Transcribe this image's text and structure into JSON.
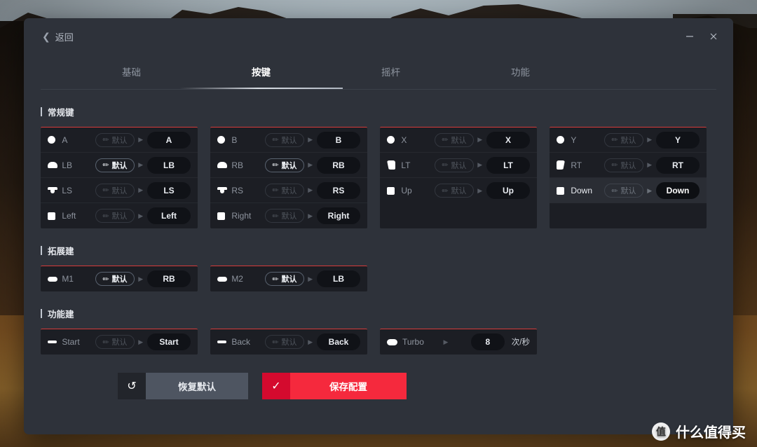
{
  "window": {
    "back_label": "返回",
    "minimize_icon": "minimize-icon",
    "close_icon": "close-icon"
  },
  "tabs": [
    {
      "label": "基础",
      "active": false
    },
    {
      "label": "按键",
      "active": true
    },
    {
      "label": "摇杆",
      "active": false
    },
    {
      "label": "功能",
      "active": false
    }
  ],
  "sections": [
    {
      "title": "常规键",
      "columns": [
        {
          "rows": [
            {
              "icon": "circle-button-icon",
              "icon_class": "ic-circle",
              "label": "A",
              "default_label": "默认",
              "default_active": false,
              "value": "A",
              "highlight": false
            },
            {
              "icon": "bumper-icon",
              "icon_class": "ic-bumper",
              "label": "LB",
              "default_label": "默认",
              "default_active": true,
              "value": "LB",
              "highlight": false
            },
            {
              "icon": "stick-icon",
              "icon_class": "ic-stick",
              "label": "LS",
              "default_label": "默认",
              "default_active": false,
              "value": "LS",
              "highlight": false
            },
            {
              "icon": "dpad-icon",
              "icon_class": "ic-dpad",
              "label": "Left",
              "default_label": "默认",
              "default_active": false,
              "value": "Left",
              "highlight": false
            }
          ]
        },
        {
          "rows": [
            {
              "icon": "circle-button-icon",
              "icon_class": "ic-circle",
              "label": "B",
              "default_label": "默认",
              "default_active": false,
              "value": "B",
              "highlight": false
            },
            {
              "icon": "bumper-icon",
              "icon_class": "ic-bumper",
              "label": "RB",
              "default_label": "默认",
              "default_active": true,
              "value": "RB",
              "highlight": false
            },
            {
              "icon": "stick-icon",
              "icon_class": "ic-stick",
              "label": "RS",
              "default_label": "默认",
              "default_active": false,
              "value": "RS",
              "highlight": false
            },
            {
              "icon": "dpad-icon",
              "icon_class": "ic-dpad",
              "label": "Right",
              "default_label": "默认",
              "default_active": false,
              "value": "Right",
              "highlight": false
            }
          ]
        },
        {
          "rows": [
            {
              "icon": "circle-button-icon",
              "icon_class": "ic-circle",
              "label": "X",
              "default_label": "默认",
              "default_active": false,
              "value": "X",
              "highlight": false
            },
            {
              "icon": "trigger-icon",
              "icon_class": "ic-trigger-l",
              "label": "LT",
              "default_label": "默认",
              "default_active": false,
              "value": "LT",
              "highlight": false
            },
            {
              "icon": "dpad-icon",
              "icon_class": "ic-dpad",
              "label": "Up",
              "default_label": "默认",
              "default_active": false,
              "value": "Up",
              "highlight": false
            }
          ]
        },
        {
          "rows": [
            {
              "icon": "circle-button-icon",
              "icon_class": "ic-circle",
              "label": "Y",
              "default_label": "默认",
              "default_active": false,
              "value": "Y",
              "highlight": false
            },
            {
              "icon": "trigger-icon",
              "icon_class": "ic-trigger-r",
              "label": "RT",
              "default_label": "默认",
              "default_active": false,
              "value": "RT",
              "highlight": false
            },
            {
              "icon": "dpad-icon",
              "icon_class": "ic-dpad",
              "label": "Down",
              "default_label": "默认",
              "default_active": false,
              "value": "Down",
              "highlight": true
            }
          ]
        }
      ]
    },
    {
      "title": "拓展建",
      "columns": [
        {
          "rows": [
            {
              "icon": "macro-key-icon",
              "icon_class": "ic-mkey",
              "label": "M1",
              "default_label": "默认",
              "default_active": true,
              "value": "RB",
              "highlight": false
            }
          ]
        },
        {
          "rows": [
            {
              "icon": "macro-key-icon",
              "icon_class": "ic-mkey",
              "label": "M2",
              "default_label": "默认",
              "default_active": true,
              "value": "LB",
              "highlight": false
            }
          ]
        }
      ]
    },
    {
      "title": "功能建",
      "columns": [
        {
          "rows": [
            {
              "icon": "start-key-icon",
              "icon_class": "ic-dash",
              "label": "Start",
              "default_label": "默认",
              "default_active": false,
              "value": "Start",
              "highlight": false
            }
          ]
        },
        {
          "rows": [
            {
              "icon": "back-key-icon",
              "icon_class": "ic-dash",
              "label": "Back",
              "default_label": "默认",
              "default_active": false,
              "value": "Back",
              "highlight": false
            }
          ]
        },
        {
          "rows": [
            {
              "icon": "turbo-key-icon",
              "icon_class": "ic-turbo",
              "label": "Turbo",
              "has_default": false,
              "value": "8",
              "unit": "次/秒",
              "highlight": false
            }
          ]
        }
      ]
    }
  ],
  "footer": {
    "restore_label": "恢复默认",
    "restore_icon": "undo-icon",
    "save_label": "保存配置",
    "save_icon": "check-icon"
  },
  "watermark": {
    "logo_text": "值",
    "text": "什么值得买"
  },
  "colors": {
    "accent_red": "#d63b3b",
    "save_red": "#f5293d",
    "save_red_dark": "#d40a2e",
    "card_bg": "#1c1e24",
    "window_bg": "#2e323a"
  }
}
